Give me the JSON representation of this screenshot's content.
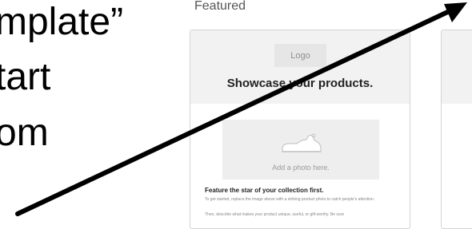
{
  "slide": {
    "lines": [
      "mplate”",
      "tart",
      "om"
    ]
  },
  "featured": {
    "label": "Featured"
  },
  "template_card": {
    "logo_label": "Logo",
    "title": "Showcase your products.",
    "photo_caption": "Add a photo here.",
    "feature_heading": "Feature the star of your collection first.",
    "paragraphs": [
      "To get started, replace the image above with a striking product photo to catch people's attention.",
      "Then, describe what makes your product unique, useful, or gift-worthy. Be sure"
    ]
  },
  "icons": {
    "shoe": "shoe-icon",
    "arrow": "arrow-annotation"
  },
  "colors": {
    "card_header_bg": "#f2f2f2",
    "photo_bg": "#eeeeee",
    "arrow": "#000000"
  }
}
